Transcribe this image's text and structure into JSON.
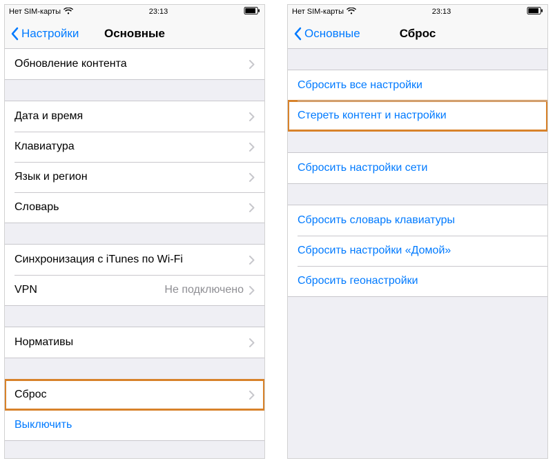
{
  "status": {
    "carrier": "Нет SIM-карты",
    "time": "23:13"
  },
  "left_screen": {
    "back_label": "Настройки",
    "title": "Основные",
    "groups": [
      {
        "first_clip": true,
        "cells": [
          {
            "label": "Обновление контента",
            "chevron": true
          }
        ]
      },
      {
        "cells": [
          {
            "label": "Дата и время",
            "chevron": true
          },
          {
            "label": "Клавиатура",
            "chevron": true
          },
          {
            "label": "Язык и регион",
            "chevron": true
          },
          {
            "label": "Словарь",
            "chevron": true
          }
        ]
      },
      {
        "cells": [
          {
            "label": "Синхронизация с iTunes по Wi-Fi",
            "chevron": true
          },
          {
            "label": "VPN",
            "detail": "Не подключено",
            "chevron": true
          }
        ]
      },
      {
        "cells": [
          {
            "label": "Нормативы",
            "chevron": true
          }
        ]
      },
      {
        "cells": [
          {
            "label": "Сброс",
            "chevron": true,
            "highlight": true
          },
          {
            "label": "Выключить",
            "action": true
          }
        ]
      }
    ]
  },
  "right_screen": {
    "back_label": "Основные",
    "title": "Сброс",
    "groups": [
      {
        "cells": [
          {
            "label": "Сбросить все настройки",
            "action": true
          },
          {
            "label": "Стереть контент и настройки",
            "action": true,
            "highlight": true
          }
        ]
      },
      {
        "cells": [
          {
            "label": "Сбросить настройки сети",
            "action": true
          }
        ]
      },
      {
        "cells": [
          {
            "label": "Сбросить словарь клавиатуры",
            "action": true
          },
          {
            "label": "Сбросить настройки «Домой»",
            "action": true
          },
          {
            "label": "Сбросить геонастройки",
            "action": true
          }
        ]
      }
    ]
  }
}
